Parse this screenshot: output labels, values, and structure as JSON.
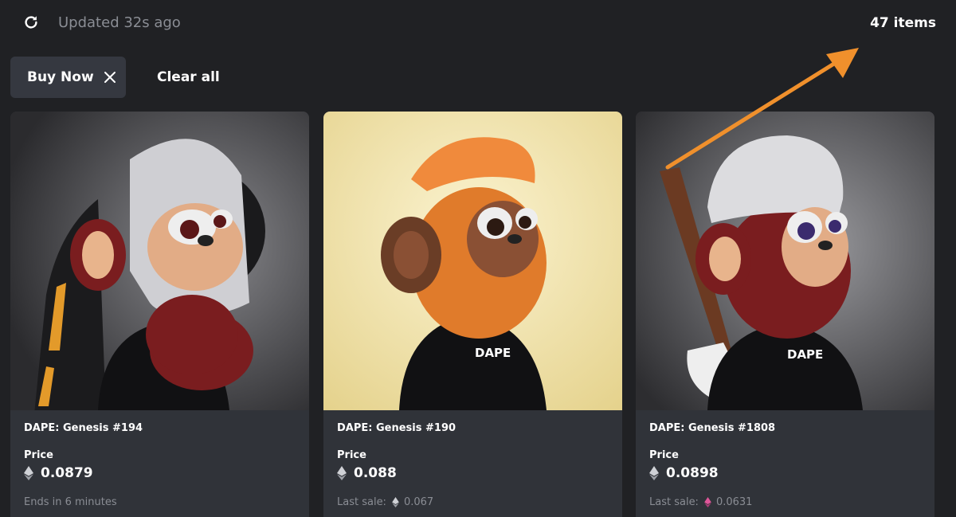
{
  "header": {
    "refresh_icon": "refresh-icon",
    "updated_text": "Updated 32s ago",
    "item_count": "47 items"
  },
  "filters": {
    "chip_label": "Buy Now",
    "chip_close_icon": "close-icon",
    "clear_label": "Clear all"
  },
  "annotation": {
    "arrow_color": "#f0902c"
  },
  "cards": [
    {
      "name": "DAPE: Genesis #194",
      "price_label": "Price",
      "price": "0.0879",
      "footer": "Ends in 6 minutes",
      "background": "#6e6e72"
    },
    {
      "name": "DAPE: Genesis #190",
      "price_label": "Price",
      "price": "0.088",
      "footer_label": "Last sale:",
      "footer_value": "0.067",
      "footer_icon_color": "#cfd1d6",
      "background": "#f2e6b4"
    },
    {
      "name": "DAPE: Genesis #1808",
      "price_label": "Price",
      "price": "0.0898",
      "footer_label": "Last sale:",
      "footer_value": "0.0631",
      "footer_icon_color": "#e0569a",
      "background": "#6e6e72"
    }
  ]
}
